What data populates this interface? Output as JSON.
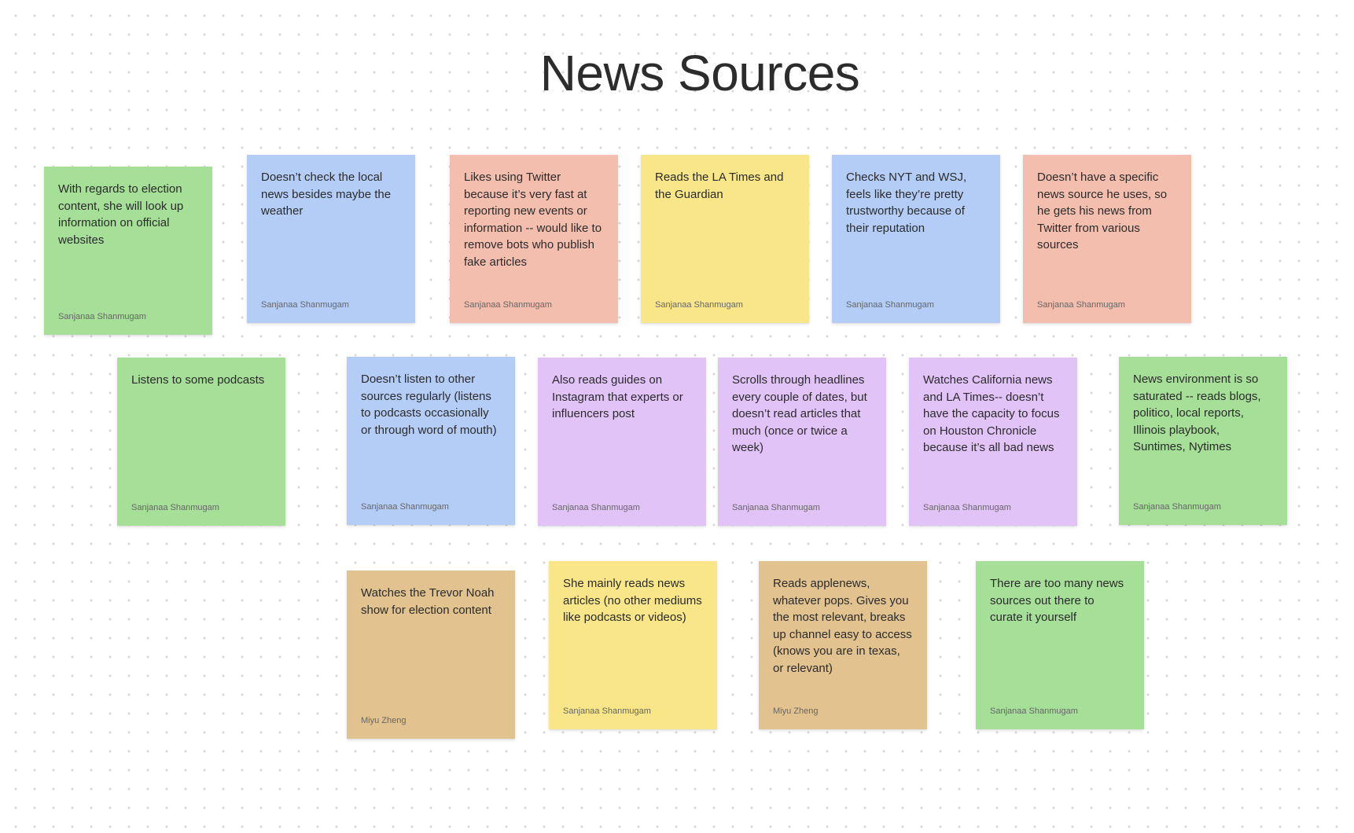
{
  "board": {
    "title": "News Sources"
  },
  "colors": {
    "green": "#a5df98",
    "blue": "#b4cdf7",
    "salmon": "#f4beae",
    "yellow": "#f8e689",
    "purple": "#e2c3f8",
    "tan": "#e2c38f"
  },
  "stickies": [
    {
      "color": "green",
      "text": "With regards to election content, she will look up information on official websites",
      "author": "Sanjanaa Shanmugam"
    },
    {
      "color": "blue",
      "text": "Doesn’t check the local news besides maybe the weather",
      "author": "Sanjanaa Shanmugam"
    },
    {
      "color": "salmon",
      "text": "Likes using Twitter because it’s very fast at reporting new events or information -- would like to remove bots who publish fake articles",
      "author": "Sanjanaa Shanmugam"
    },
    {
      "color": "yellow",
      "text": "Reads the LA Times and the Guardian",
      "author": "Sanjanaa Shanmugam"
    },
    {
      "color": "blue",
      "text": "Checks NYT and WSJ, feels like they’re pretty trustworthy because of their reputation",
      "author": "Sanjanaa Shanmugam"
    },
    {
      "color": "salmon",
      "text": "Doesn’t have a specific news source he uses, so he gets his news from Twitter from various sources",
      "author": "Sanjanaa Shanmugam"
    },
    {
      "color": "green",
      "text": "Listens to some podcasts",
      "author": "Sanjanaa Shanmugam"
    },
    {
      "color": "blue",
      "text": "Doesn’t listen to other sources regularly (listens to podcasts occasionally or through word of mouth)",
      "author": "Sanjanaa Shanmugam"
    },
    {
      "color": "purple",
      "text": "Also reads guides on Instagram that experts or influencers post",
      "author": "Sanjanaa Shanmugam"
    },
    {
      "color": "purple",
      "text": "Scrolls through headlines every couple of dates, but doesn’t read articles that much (once or twice a week)",
      "author": "Sanjanaa Shanmugam"
    },
    {
      "color": "purple",
      "text": "Watches California news and LA Times-- doesn’t have the capacity to focus on Houston Chronicle because it’s all bad news",
      "author": "Sanjanaa Shanmugam"
    },
    {
      "color": "green",
      "text": "News environment is so saturated -- reads blogs, politico, local reports, Illinois playbook, Suntimes, Nytimes",
      "author": "Sanjanaa Shanmugam"
    },
    {
      "color": "tan",
      "text": "Watches the Trevor Noah show for election content",
      "author": "Miyu Zheng"
    },
    {
      "color": "yellow",
      "text": "She mainly reads news articles (no other mediums like podcasts or videos)",
      "author": "Sanjanaa Shanmugam"
    },
    {
      "color": "tan",
      "text": "Reads applenews, whatever pops. Gives you the most relevant, breaks up channel easy to access (knows you are in texas, or relevant)",
      "author": "Miyu Zheng"
    },
    {
      "color": "green",
      "text": "There are too many news sources out there to curate it yourself",
      "author": "Sanjanaa Shanmugam"
    }
  ]
}
